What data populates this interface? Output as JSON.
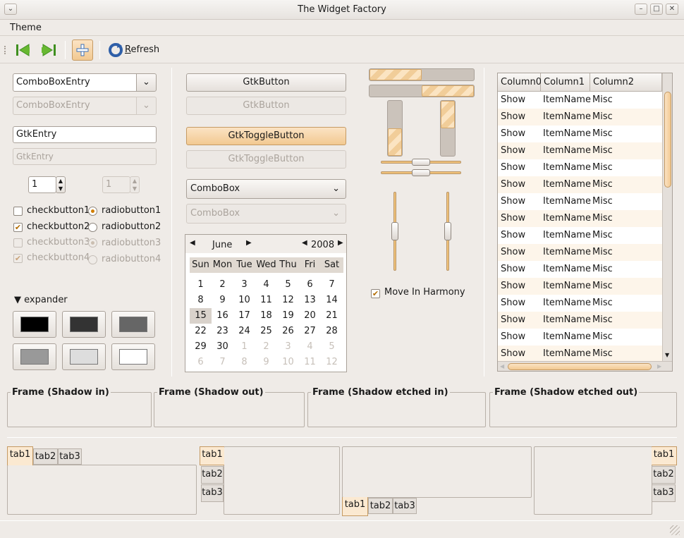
{
  "window": {
    "title": "The Widget Factory"
  },
  "menu": {
    "theme": "Theme"
  },
  "toolbar": {
    "refresh": "Refresh",
    "refresh_mnemonic": "R",
    "refresh_rest": "efresh"
  },
  "left": {
    "combo_entry": "ComboBoxEntry",
    "combo_entry_disabled": "ComboBoxEntry",
    "entry": "GtkEntry",
    "entry_disabled": "GtkEntry",
    "spin": "1",
    "spin_disabled": "1",
    "checks": [
      "checkbutton1",
      "checkbutton2",
      "checkbutton3",
      "checkbutton4"
    ],
    "radios": [
      "radiobutton1",
      "radiobutton2",
      "radiobutton3",
      "radiobutton4"
    ],
    "expander": "expander",
    "swatch_colors": [
      "#000000",
      "#333333",
      "#666666",
      "#999999",
      "#dddddd",
      "#ffffff"
    ]
  },
  "middle": {
    "button": "GtkButton",
    "button_disabled": "GtkButton",
    "toggle": "GtkToggleButton",
    "toggle_disabled": "GtkToggleButton",
    "combo": "ComboBox",
    "combo_disabled": "ComboBox",
    "calendar": {
      "month": "June",
      "year": "2008",
      "weekdays": [
        "Sun",
        "Mon",
        "Tue",
        "Wed",
        "Thu",
        "Fri",
        "Sat"
      ],
      "weeks": [
        [
          "1",
          "2",
          "3",
          "4",
          "5",
          "6",
          "7"
        ],
        [
          "8",
          "9",
          "10",
          "11",
          "12",
          "13",
          "14"
        ],
        [
          "15",
          "16",
          "17",
          "18",
          "19",
          "20",
          "21"
        ],
        [
          "22",
          "23",
          "24",
          "25",
          "26",
          "27",
          "28"
        ],
        [
          "29",
          "30",
          "1",
          "2",
          "3",
          "4",
          "5"
        ],
        [
          "6",
          "7",
          "8",
          "9",
          "10",
          "11",
          "12"
        ]
      ],
      "selected": "15"
    }
  },
  "ranges": {
    "progress_h": [
      0.5,
      0.5
    ],
    "progress_v": [
      0.5,
      0.5
    ],
    "scale_h": [
      0.5,
      0.5
    ],
    "scale_v": [
      0.5,
      0.5
    ],
    "harmony_label": "Move In Harmony"
  },
  "tree": {
    "columns": [
      "Column0",
      "Column1",
      "Column2"
    ],
    "rows": [
      [
        "Show",
        "ItemName",
        "Misc"
      ],
      [
        "Show",
        "ItemName",
        "Misc"
      ],
      [
        "Show",
        "ItemName",
        "Misc"
      ],
      [
        "Show",
        "ItemName",
        "Misc"
      ],
      [
        "Show",
        "ItemName",
        "Misc"
      ],
      [
        "Show",
        "ItemName",
        "Misc"
      ],
      [
        "Show",
        "ItemName",
        "Misc"
      ],
      [
        "Show",
        "ItemName",
        "Misc"
      ],
      [
        "Show",
        "ItemName",
        "Misc"
      ],
      [
        "Show",
        "ItemName",
        "Misc"
      ],
      [
        "Show",
        "ItemName",
        "Misc"
      ],
      [
        "Show",
        "ItemName",
        "Misc"
      ],
      [
        "Show",
        "ItemName",
        "Misc"
      ],
      [
        "Show",
        "ItemName",
        "Misc"
      ],
      [
        "Show",
        "ItemName",
        "Misc"
      ],
      [
        "Show",
        "ItemName",
        "Misc"
      ]
    ]
  },
  "frames": [
    "Frame (Shadow in)",
    "Frame (Shadow out)",
    "Frame (Shadow etched in)",
    "Frame (Shadow etched out)"
  ],
  "tabs": [
    "tab1",
    "tab2",
    "tab3"
  ],
  "colors": {
    "accent": "#f2c991",
    "selection": "#fbe9d1"
  }
}
